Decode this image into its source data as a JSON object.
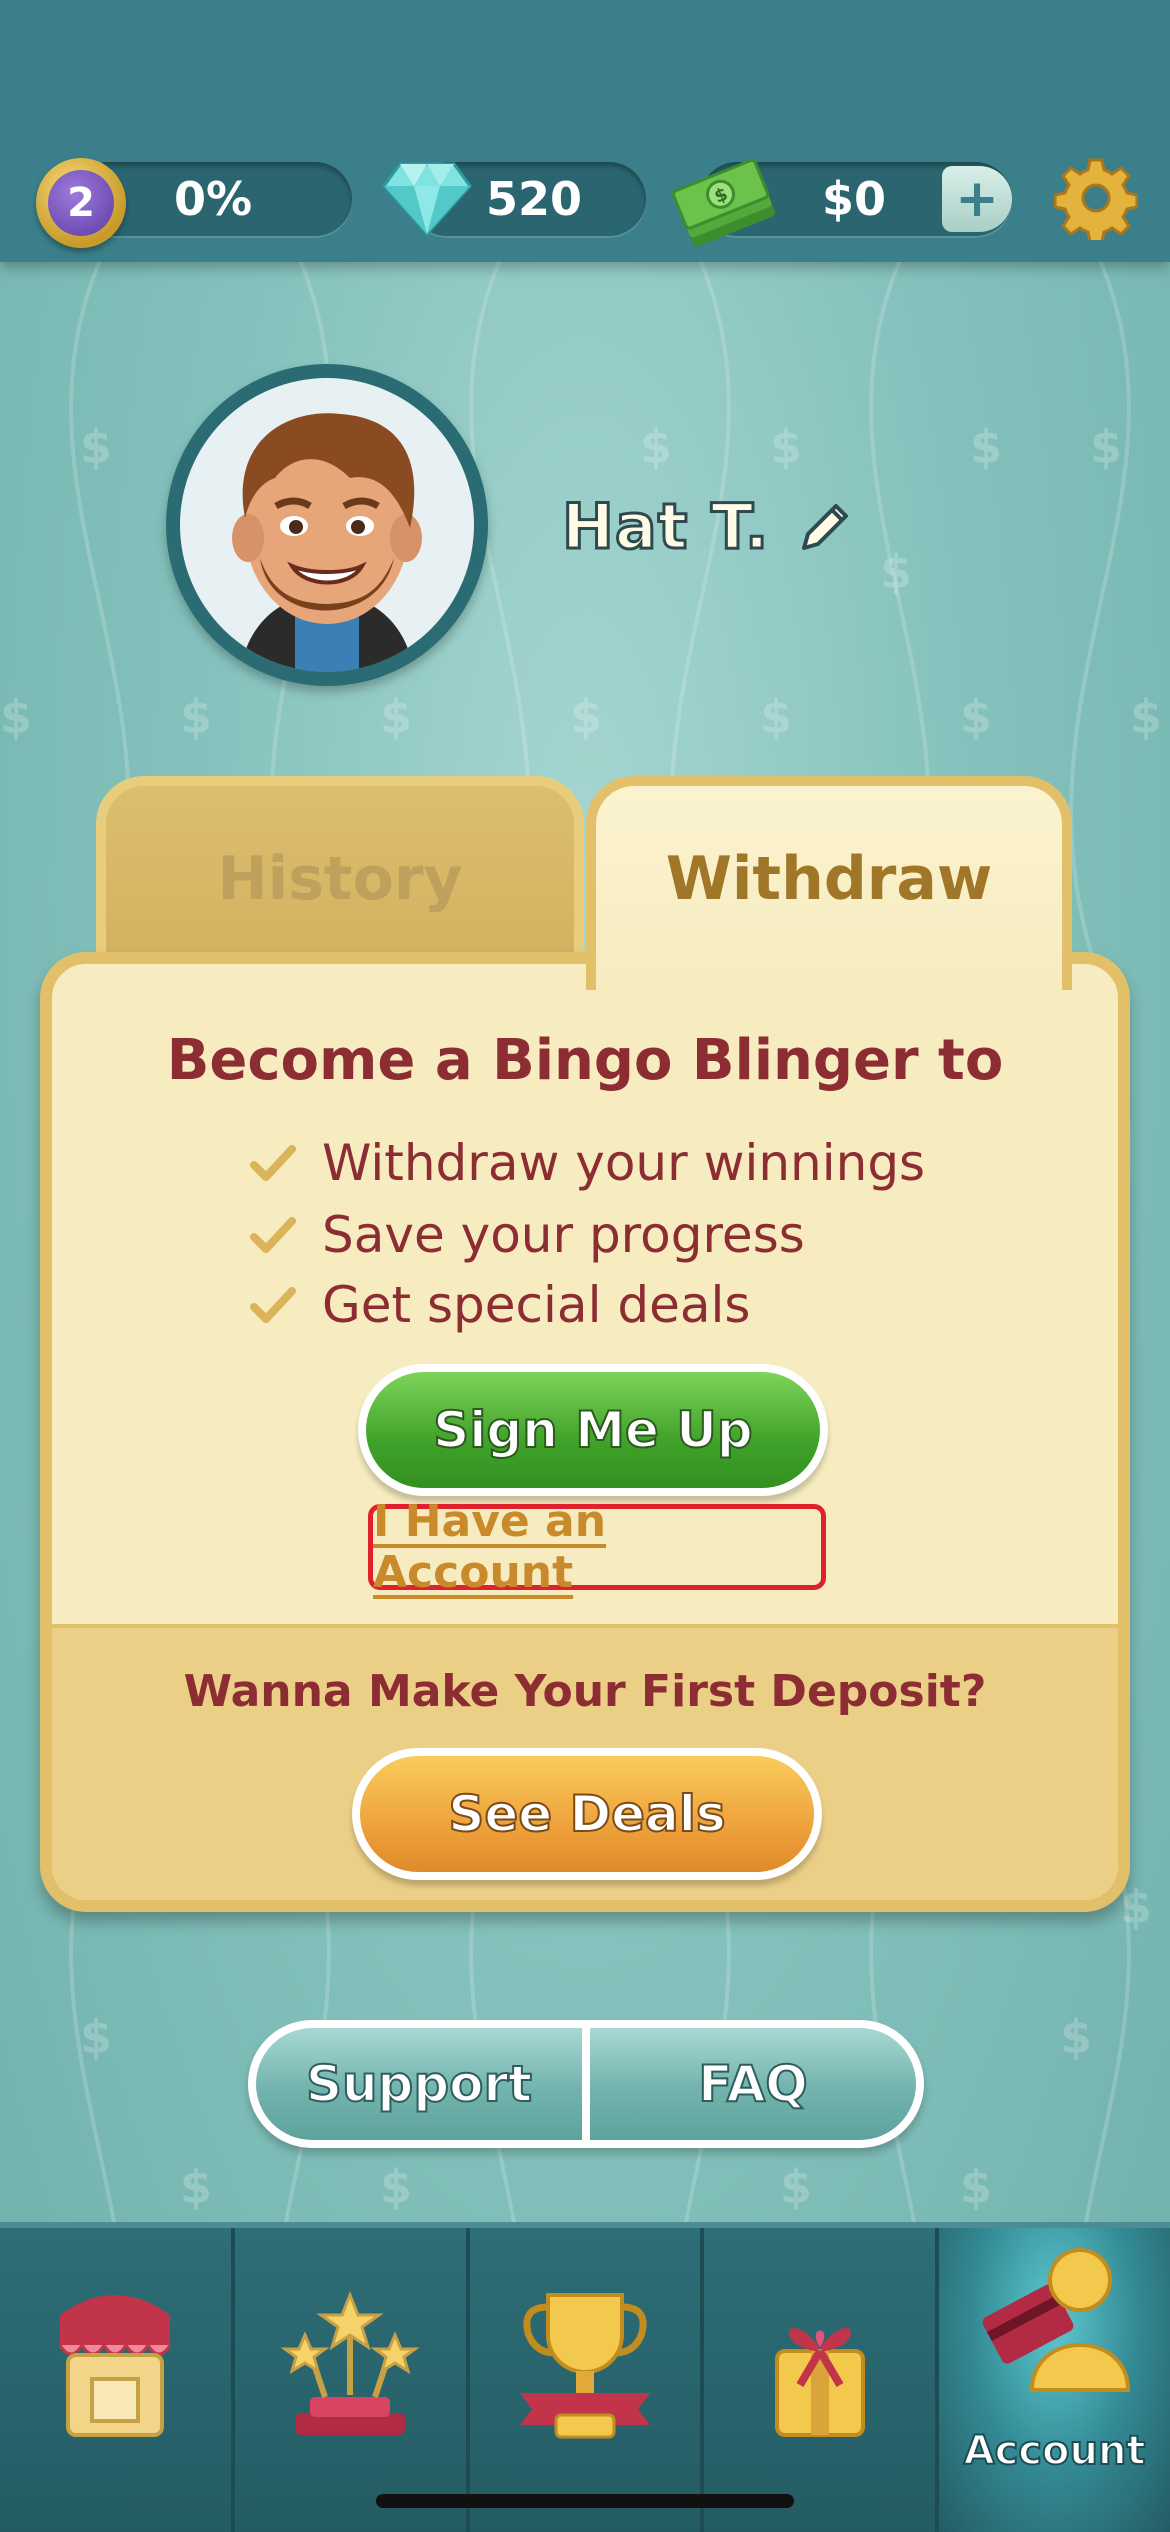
{
  "topbar": {
    "level": "2",
    "level_progress": "0%",
    "gems": "520",
    "cash": "$0",
    "plus_label": "+"
  },
  "profile": {
    "username": "Hat T."
  },
  "tabs": [
    {
      "label": "History",
      "active": false
    },
    {
      "label": "Withdraw",
      "active": true
    }
  ],
  "card": {
    "title": "Become a Bingo Blinger to",
    "benefits": [
      "Withdraw your winnings",
      "Save your progress",
      "Get special deals"
    ],
    "signup_label": "Sign Me Up",
    "account_link": "I Have an Account",
    "deposit_prompt": "Wanna Make Your First Deposit?",
    "deals_label": "See Deals"
  },
  "support": {
    "support_label": "Support",
    "faq_label": "FAQ"
  },
  "bottom_nav": {
    "items": [
      {
        "icon": "shop-icon"
      },
      {
        "icon": "stars-icon"
      },
      {
        "icon": "trophy-icon"
      },
      {
        "icon": "gift-icon"
      },
      {
        "icon": "account-icon",
        "label": "Account",
        "active": true
      }
    ]
  },
  "colors": {
    "accent_red": "#8c2c33",
    "card_bg": "#f7ecc0",
    "topbar": "#3a7f89",
    "highlight_border": "#e0202a"
  }
}
